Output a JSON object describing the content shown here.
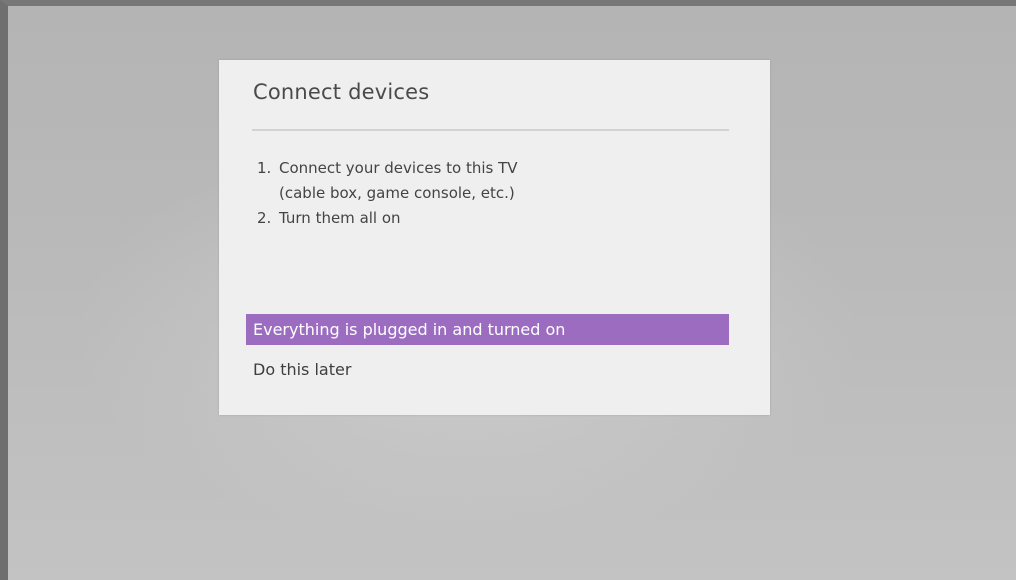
{
  "dialog": {
    "title": "Connect devices",
    "steps": [
      {
        "number": "1.",
        "text": "Connect your devices to this TV\n(cable box, game console, etc.)"
      },
      {
        "number": "2.",
        "text": "Turn them all on"
      }
    ],
    "options": [
      {
        "label": "Everything is plugged in and turned on",
        "focused": true
      },
      {
        "label": "Do this later",
        "focused": false
      }
    ]
  },
  "colors": {
    "background": "#b9b9b9",
    "dialog": "#efefef",
    "focus_highlight": "#9b6cc0",
    "text": "#444444"
  }
}
